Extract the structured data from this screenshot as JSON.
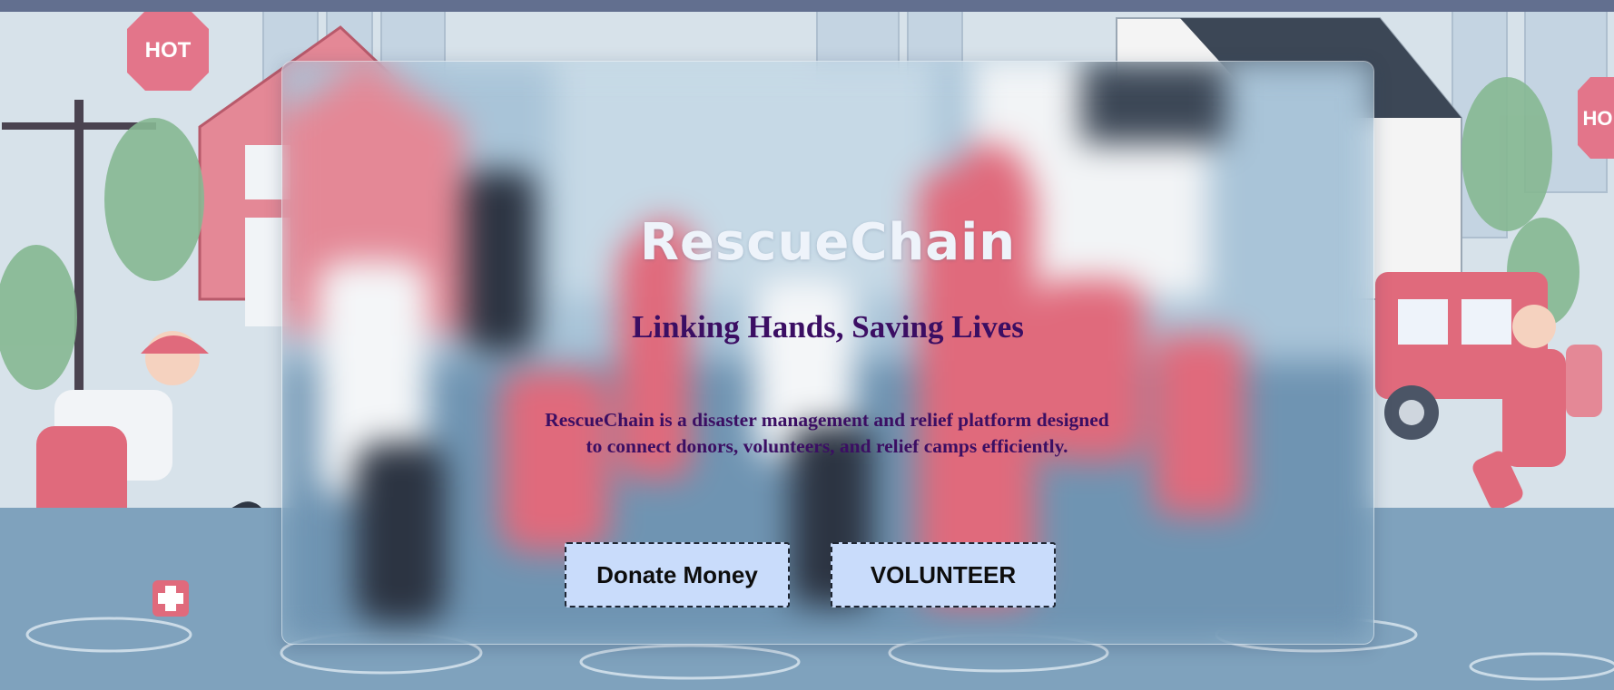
{
  "header": {
    "app_title": "RescueChain",
    "tagline": "Linking Hands, Saving Lives",
    "description": "RescueChain is a disaster management and relief platform designed to connect donors, volunteers, and relief camps efficiently."
  },
  "actions": {
    "donate_label": "Donate Money",
    "volunteer_label": "VOLUNTEER"
  },
  "background": {
    "signs": [
      "HOT",
      "HO"
    ]
  },
  "colors": {
    "top_bar": "#626f8f",
    "title_text": "#eef3fa",
    "accent_text": "#3b0e63",
    "button_bg": "#c9dcfb",
    "button_border": "#1f2633",
    "rescue_red": "#e06a7c",
    "water": "#7fa2bd"
  }
}
